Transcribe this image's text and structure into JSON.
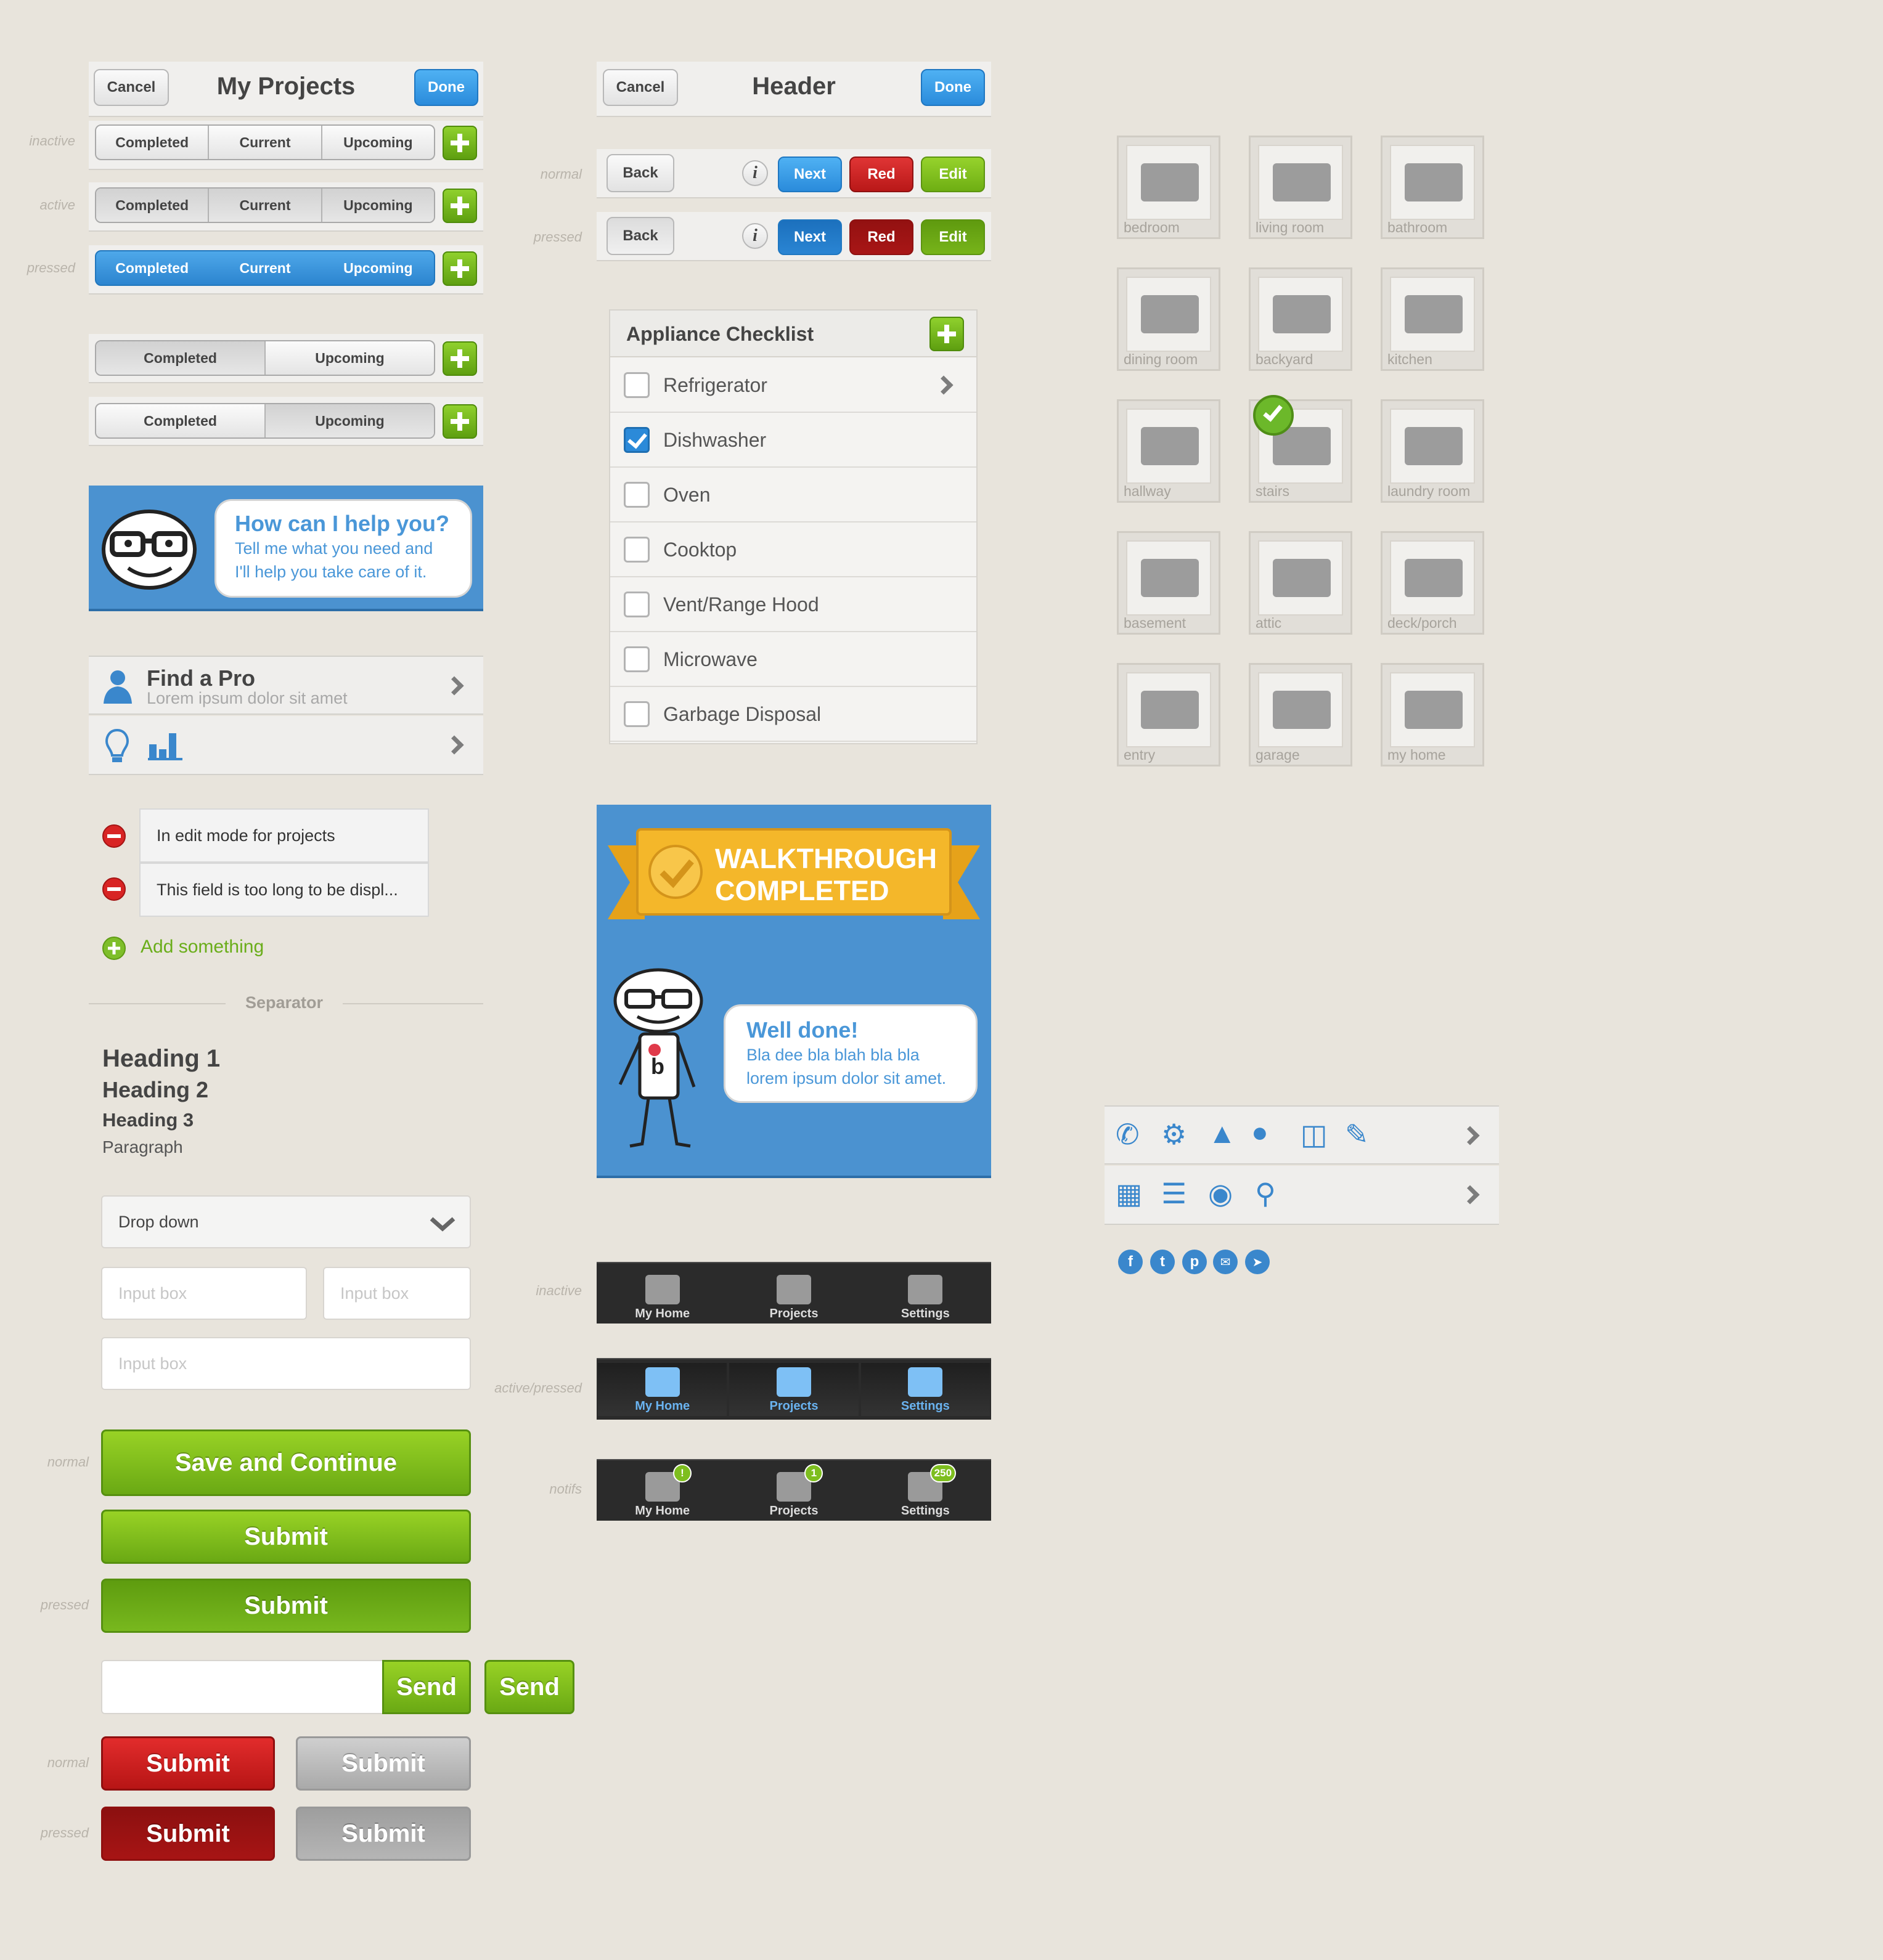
{
  "state_labels": {
    "inactive": "inactive",
    "active": "active",
    "pressed": "pressed",
    "normal": "normal",
    "active_pressed": "active/pressed",
    "notifs": "notifs"
  },
  "projects_header": {
    "cancel": "Cancel",
    "title": "My Projects",
    "done": "Done"
  },
  "segments": {
    "three": [
      "Completed",
      "Current",
      "Upcoming"
    ],
    "two": [
      "Completed",
      "Upcoming"
    ]
  },
  "generic_header": {
    "cancel": "Cancel",
    "title": "Header",
    "done": "Done"
  },
  "nav_buttons": {
    "back": "Back",
    "info": "i",
    "next": "Next",
    "red": "Red",
    "edit": "Edit"
  },
  "help": {
    "title": "How can I help you?",
    "line1": "Tell me what you need and",
    "line2": "I'll help you take care of it."
  },
  "find_pro": {
    "title": "Find a Pro",
    "subtitle": "Lorem ipsum dolor sit amet"
  },
  "edit_mode": {
    "field1": "In edit mode for projects",
    "field2": "This field is too long to be displ...",
    "add": "Add something"
  },
  "separator": "Separator",
  "typography": {
    "h1": "Heading 1",
    "h2": "Heading 2",
    "h3": "Heading 3",
    "p": "Paragraph"
  },
  "form": {
    "dropdown": "Drop down",
    "input_placeholder": "Input box"
  },
  "buttons": {
    "save_continue": "Save and Continue",
    "submit": "Submit",
    "send": "Send"
  },
  "checklist": {
    "title": "Appliance Checklist",
    "items": [
      {
        "label": "Refrigerator",
        "checked": false
      },
      {
        "label": "Dishwasher",
        "checked": true
      },
      {
        "label": "Oven",
        "checked": false
      },
      {
        "label": "Cooktop",
        "checked": false
      },
      {
        "label": "Vent/Range Hood",
        "checked": false
      },
      {
        "label": "Microwave",
        "checked": false
      },
      {
        "label": "Garbage Disposal",
        "checked": false
      }
    ]
  },
  "walkthrough": {
    "banner_line1": "WALKTHROUGH",
    "banner_line2": "COMPLETED",
    "bubble_title": "Well done!",
    "bubble_line1": "Bla dee bla blah bla bla",
    "bubble_line2": "lorem ipsum dolor sit amet.",
    "shirt_letter": "b"
  },
  "tabbar": {
    "items": [
      "My Home",
      "Projects",
      "Settings"
    ],
    "badges": [
      "!",
      "1",
      "250"
    ]
  },
  "rooms": [
    "bedroom",
    "living room",
    "bathroom",
    "dining room",
    "backyard",
    "kitchen",
    "hallway",
    "stairs",
    "laundry room",
    "basement",
    "attic",
    "deck/porch",
    "entry",
    "garage",
    "my home"
  ],
  "icon_rows": {
    "row1": [
      "phone-icon",
      "gears-icon",
      "warning-icon",
      "chat-icon",
      "trash-icon",
      "pencil-icon"
    ],
    "row2": [
      "calendar-icon",
      "checklist-icon",
      "camera-icon",
      "location-pin-icon"
    ],
    "social": [
      "facebook-icon",
      "twitter-icon",
      "pinterest-icon",
      "email-icon",
      "cursor-icon"
    ]
  },
  "colors": {
    "background": "#e8e4dc",
    "blue": "#2b8ad9",
    "green": "#7ebe2a",
    "red": "#c81b1b"
  }
}
